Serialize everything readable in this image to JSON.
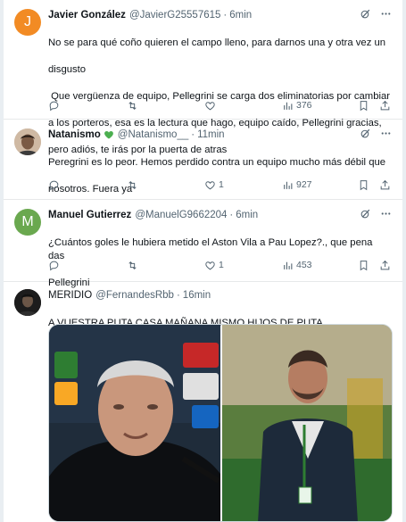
{
  "tweets": [
    {
      "avatar_letter": "J",
      "avatar_color": "#f28b24",
      "name": "Javier González",
      "handle": "@JavierG25557615",
      "time": "6min",
      "text_lines": [
        "No se para qué coño quieren el campo lleno, para darnos una y otra vez un",
        "disgusto",
        " Que vergüenza de equipo, Pellegrini se carga dos eliminatorias por cambiar",
        "a los porteros, esa es la lectura que hago, equipo caído, Pellegrini gracias,",
        "pero adiós, te irás por la puerta de atras"
      ],
      "likes": "",
      "views": "376"
    },
    {
      "name": "Natanismo",
      "handle": "@Natanismo__",
      "time": "11min",
      "text_lines": [
        "Peregrini es lo peor. Hemos perdido contra un equipo mucho más débil que",
        "nosotros. Fuera ya"
      ],
      "likes": "1",
      "views": "927"
    },
    {
      "avatar_letter": "M",
      "avatar_color": "#6aa84f",
      "name": "Manuel Gutierrez",
      "handle": "@ManuelG9662204",
      "time": "6min",
      "text_lines": [
        "¿Cuántos goles le hubiera metido el Aston Vila a Pau Lopez?., que pena das",
        "Pellegrini"
      ],
      "likes": "1",
      "views": "453"
    },
    {
      "name": "MERIDIO",
      "handle": "@FernandesRbb",
      "time": "16min",
      "text_lines": [
        "A VUESTRA PUTA CASA MAÑANA MISMO HIJOS DE PUTA."
      ]
    }
  ],
  "separator": "·",
  "colors": {
    "heart_green": "#4caf50",
    "icon_gray": "#536471"
  }
}
